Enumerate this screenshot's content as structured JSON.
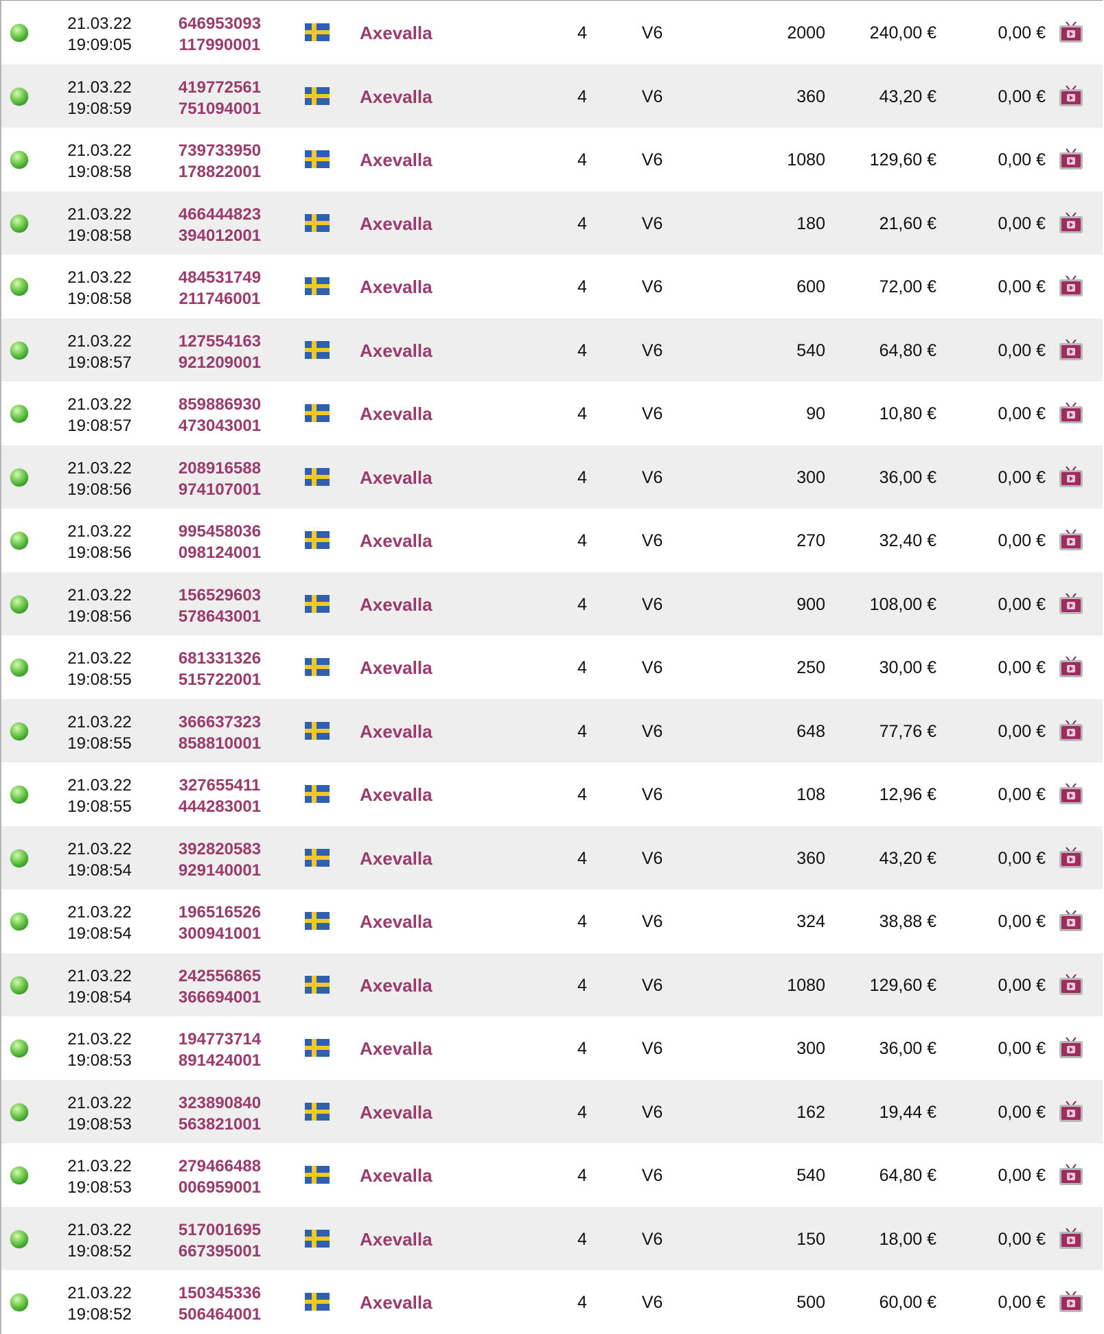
{
  "colors": {
    "link": "#9b3b6b",
    "row_alt": "#eeeeee",
    "status_ok": "#4cb838",
    "flag_blue": "#2f5fb0",
    "flag_yellow": "#f2c824"
  },
  "icons": {
    "status": "green-dot-icon",
    "flag": "sweden-flag-icon",
    "video": "tv-icon"
  },
  "rows": [
    {
      "date": "21.03.22",
      "time": "19:09:05",
      "ticket_a": "646953093",
      "ticket_b": "117990001",
      "track": "Axevalla",
      "race": "4",
      "game": "V6",
      "stake": "2000",
      "amount": "240,00 €",
      "payout": "0,00 €"
    },
    {
      "date": "21.03.22",
      "time": "19:08:59",
      "ticket_a": "419772561",
      "ticket_b": "751094001",
      "track": "Axevalla",
      "race": "4",
      "game": "V6",
      "stake": "360",
      "amount": "43,20 €",
      "payout": "0,00 €"
    },
    {
      "date": "21.03.22",
      "time": "19:08:58",
      "ticket_a": "739733950",
      "ticket_b": "178822001",
      "track": "Axevalla",
      "race": "4",
      "game": "V6",
      "stake": "1080",
      "amount": "129,60 €",
      "payout": "0,00 €"
    },
    {
      "date": "21.03.22",
      "time": "19:08:58",
      "ticket_a": "466444823",
      "ticket_b": "394012001",
      "track": "Axevalla",
      "race": "4",
      "game": "V6",
      "stake": "180",
      "amount": "21,60 €",
      "payout": "0,00 €"
    },
    {
      "date": "21.03.22",
      "time": "19:08:58",
      "ticket_a": "484531749",
      "ticket_b": "211746001",
      "track": "Axevalla",
      "race": "4",
      "game": "V6",
      "stake": "600",
      "amount": "72,00 €",
      "payout": "0,00 €"
    },
    {
      "date": "21.03.22",
      "time": "19:08:57",
      "ticket_a": "127554163",
      "ticket_b": "921209001",
      "track": "Axevalla",
      "race": "4",
      "game": "V6",
      "stake": "540",
      "amount": "64,80 €",
      "payout": "0,00 €"
    },
    {
      "date": "21.03.22",
      "time": "19:08:57",
      "ticket_a": "859886930",
      "ticket_b": "473043001",
      "track": "Axevalla",
      "race": "4",
      "game": "V6",
      "stake": "90",
      "amount": "10,80 €",
      "payout": "0,00 €"
    },
    {
      "date": "21.03.22",
      "time": "19:08:56",
      "ticket_a": "208916588",
      "ticket_b": "974107001",
      "track": "Axevalla",
      "race": "4",
      "game": "V6",
      "stake": "300",
      "amount": "36,00 €",
      "payout": "0,00 €"
    },
    {
      "date": "21.03.22",
      "time": "19:08:56",
      "ticket_a": "995458036",
      "ticket_b": "098124001",
      "track": "Axevalla",
      "race": "4",
      "game": "V6",
      "stake": "270",
      "amount": "32,40 €",
      "payout": "0,00 €"
    },
    {
      "date": "21.03.22",
      "time": "19:08:56",
      "ticket_a": "156529603",
      "ticket_b": "578643001",
      "track": "Axevalla",
      "race": "4",
      "game": "V6",
      "stake": "900",
      "amount": "108,00 €",
      "payout": "0,00 €"
    },
    {
      "date": "21.03.22",
      "time": "19:08:55",
      "ticket_a": "681331326",
      "ticket_b": "515722001",
      "track": "Axevalla",
      "race": "4",
      "game": "V6",
      "stake": "250",
      "amount": "30,00 €",
      "payout": "0,00 €"
    },
    {
      "date": "21.03.22",
      "time": "19:08:55",
      "ticket_a": "366637323",
      "ticket_b": "858810001",
      "track": "Axevalla",
      "race": "4",
      "game": "V6",
      "stake": "648",
      "amount": "77,76 €",
      "payout": "0,00 €"
    },
    {
      "date": "21.03.22",
      "time": "19:08:55",
      "ticket_a": "327655411",
      "ticket_b": "444283001",
      "track": "Axevalla",
      "race": "4",
      "game": "V6",
      "stake": "108",
      "amount": "12,96 €",
      "payout": "0,00 €"
    },
    {
      "date": "21.03.22",
      "time": "19:08:54",
      "ticket_a": "392820583",
      "ticket_b": "929140001",
      "track": "Axevalla",
      "race": "4",
      "game": "V6",
      "stake": "360",
      "amount": "43,20 €",
      "payout": "0,00 €"
    },
    {
      "date": "21.03.22",
      "time": "19:08:54",
      "ticket_a": "196516526",
      "ticket_b": "300941001",
      "track": "Axevalla",
      "race": "4",
      "game": "V6",
      "stake": "324",
      "amount": "38,88 €",
      "payout": "0,00 €"
    },
    {
      "date": "21.03.22",
      "time": "19:08:54",
      "ticket_a": "242556865",
      "ticket_b": "366694001",
      "track": "Axevalla",
      "race": "4",
      "game": "V6",
      "stake": "1080",
      "amount": "129,60 €",
      "payout": "0,00 €"
    },
    {
      "date": "21.03.22",
      "time": "19:08:53",
      "ticket_a": "194773714",
      "ticket_b": "891424001",
      "track": "Axevalla",
      "race": "4",
      "game": "V6",
      "stake": "300",
      "amount": "36,00 €",
      "payout": "0,00 €"
    },
    {
      "date": "21.03.22",
      "time": "19:08:53",
      "ticket_a": "323890840",
      "ticket_b": "563821001",
      "track": "Axevalla",
      "race": "4",
      "game": "V6",
      "stake": "162",
      "amount": "19,44 €",
      "payout": "0,00 €"
    },
    {
      "date": "21.03.22",
      "time": "19:08:53",
      "ticket_a": "279466488",
      "ticket_b": "006959001",
      "track": "Axevalla",
      "race": "4",
      "game": "V6",
      "stake": "540",
      "amount": "64,80 €",
      "payout": "0,00 €"
    },
    {
      "date": "21.03.22",
      "time": "19:08:52",
      "ticket_a": "517001695",
      "ticket_b": "667395001",
      "track": "Axevalla",
      "race": "4",
      "game": "V6",
      "stake": "150",
      "amount": "18,00 €",
      "payout": "0,00 €"
    },
    {
      "date": "21.03.22",
      "time": "19:08:52",
      "ticket_a": "150345336",
      "ticket_b": "506464001",
      "track": "Axevalla",
      "race": "4",
      "game": "V6",
      "stake": "500",
      "amount": "60,00 €",
      "payout": "0,00 €"
    }
  ]
}
